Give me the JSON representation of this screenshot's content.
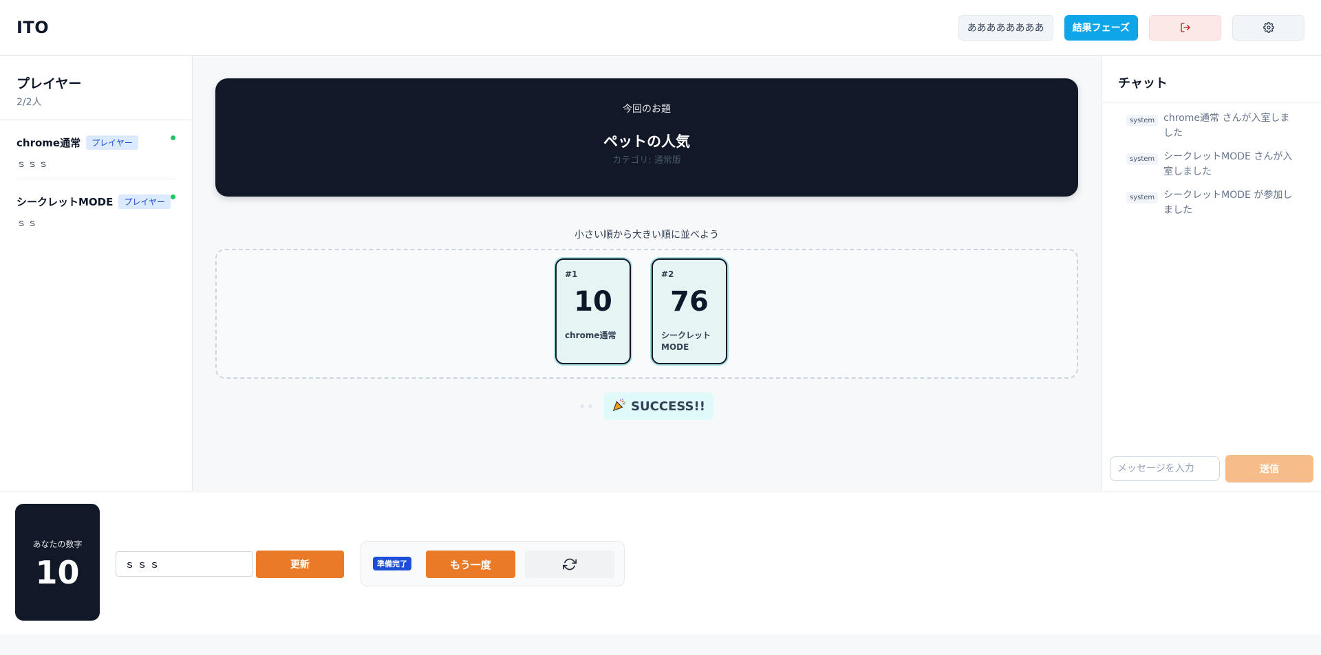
{
  "header": {
    "logo": "ITO",
    "room_name": "ああああああああ",
    "phase_button": "結果フェーズ",
    "icons": {
      "exit": "logout-icon",
      "settings": "gear-icon"
    }
  },
  "players_panel": {
    "title": "プレイヤー",
    "count": "2/2人",
    "players": [
      {
        "name": "chrome通常",
        "role": "プレイヤー",
        "word": "ｓｓｓ",
        "status_color": "#22c55e"
      },
      {
        "name": "シークレットMODE",
        "role": "プレイヤー",
        "word": "ｓｓ",
        "status_color": "#22c55e"
      }
    ]
  },
  "topic": {
    "label": "今回のお題",
    "title": "ペットの人気",
    "category": "カテゴリ: 通常版"
  },
  "board": {
    "instruction": "小さい順から大きい順に並べよう",
    "cards": [
      {
        "index": "#1",
        "value": "10",
        "name": "chrome通常"
      },
      {
        "index": "#2",
        "value": "76",
        "name": "シークレットMODE"
      }
    ],
    "result": "SUCCESS!!",
    "result_icon": "party-popper-icon"
  },
  "chat": {
    "title": "チャット",
    "messages": [
      {
        "tag": "system",
        "text": "chrome通常 さんが入室しました"
      },
      {
        "tag": "system",
        "text": "シークレットMODE さんが入室しました"
      },
      {
        "tag": "system",
        "text": "シークレットMODE が参加しました"
      }
    ],
    "input_placeholder": "メッセージを入力",
    "send_label": "送信"
  },
  "bottom": {
    "my_number_label": "あなたの数字",
    "my_number": "10",
    "word_value": "ｓｓｓ",
    "update_label": "更新",
    "ready_badge": "準備完了",
    "again_label": "もう一度",
    "refresh_icon": "refresh-icon"
  },
  "colors": {
    "accent": "#ea7a28",
    "phase": "#0ea5e9",
    "dark": "#111827",
    "online": "#22c55e"
  }
}
